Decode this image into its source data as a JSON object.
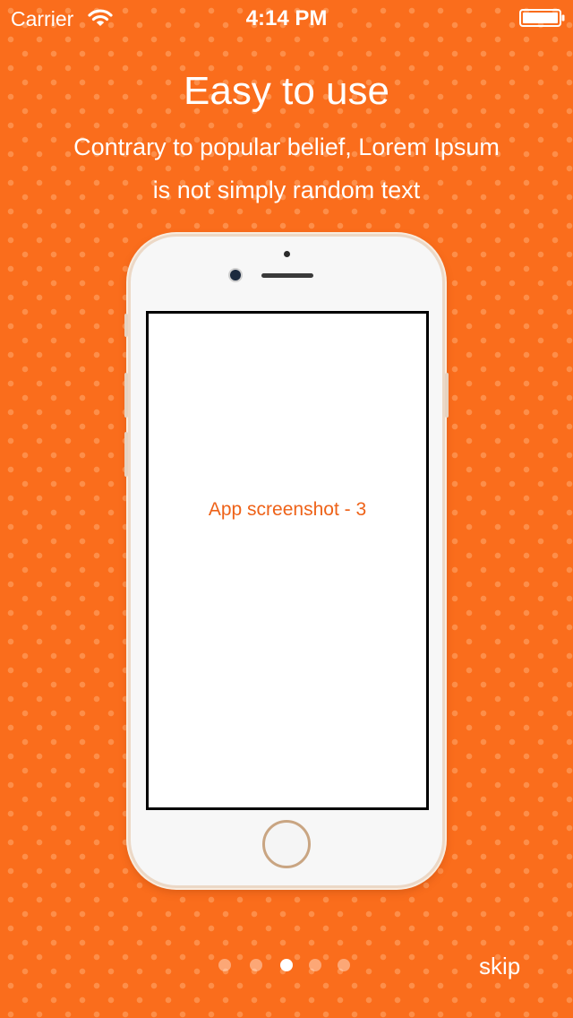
{
  "status_bar": {
    "carrier": "Carrier",
    "time": "4:14 PM"
  },
  "onboarding": {
    "title": "Easy to use",
    "subtitle": "Contrary to popular belief, Lorem Ipsum is not simply random text",
    "screenshot_label": "App screenshot - 3",
    "skip_label": "skip"
  },
  "pager": {
    "total_pages": 5,
    "current_page": 3
  },
  "colors": {
    "background": "#fa6d1c",
    "accent_text": "#ee6218"
  }
}
